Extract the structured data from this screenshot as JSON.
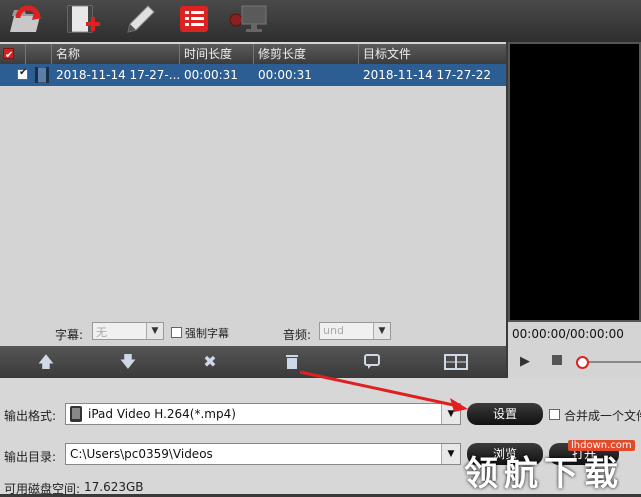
{
  "toolbar": {
    "buttons": [
      {
        "name": "add-file-icon"
      },
      {
        "name": "add-video-icon"
      },
      {
        "name": "edit-icon"
      },
      {
        "name": "task-list-icon"
      },
      {
        "name": "settings-monitor-icon"
      }
    ]
  },
  "list": {
    "headers": {
      "name": "名称",
      "duration": "时间长度",
      "trim": "修剪长度",
      "target": "目标文件"
    },
    "rows": [
      {
        "name": "2018-11-14 17-27-...",
        "duration": "00:00:31",
        "trim": "00:00:31",
        "target": "2018-11-14 17-27-22"
      }
    ]
  },
  "subtitle": {
    "label": "字幕:",
    "value": "无",
    "force_label": "强制字幕"
  },
  "audio": {
    "label": "音频:",
    "value": "und"
  },
  "preview": {
    "time": "00:00:00/00:00:00"
  },
  "output": {
    "format_label": "输出格式:",
    "format_value": "iPad Video H.264(*.mp4)",
    "settings_button": "设置",
    "merge_label": "合并成一个文件",
    "dir_label": "输出目录:",
    "dir_value": "C:\\Users\\pc0359\\Videos",
    "browse_button": "浏览",
    "open_button": "打开",
    "space_label": "可用磁盘空间:",
    "space_value": "17.623GB"
  },
  "watermark": {
    "site": "lhdown.com",
    "text": "领航下载"
  }
}
